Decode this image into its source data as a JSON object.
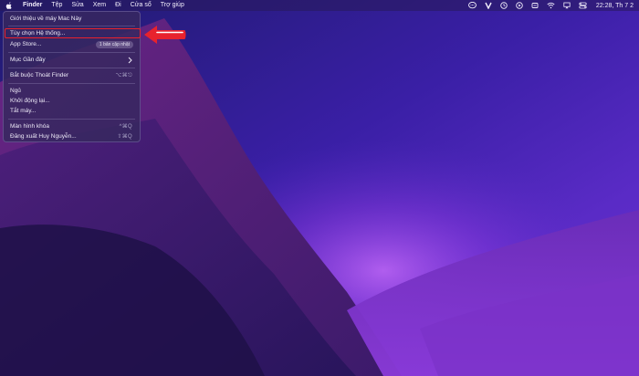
{
  "menubar": {
    "items": [
      "Finder",
      "Tệp",
      "Sửa",
      "Xem",
      "Đi",
      "Cửa sổ",
      "Trợ giúp"
    ],
    "clock": "22:28, Th 7 2"
  },
  "apple_menu": {
    "about": "Giới thiệu về máy Mac Này",
    "system_prefs": "Tùy chọn Hệ thống...",
    "app_store": "App Store...",
    "app_store_badge": "1 bản cập nhật",
    "recent_items": "Mục Gần đây",
    "force_quit": "Bắt buộc Thoát Finder",
    "force_quit_shortcut": "⌥⌘⎋",
    "sleep": "Ngủ",
    "restart": "Khởi động lại...",
    "shutdown": "Tắt máy...",
    "lock_screen": "Màn hình khóa",
    "lock_screen_shortcut": "^⌘Q",
    "logout": "Đăng xuất Huy Nguyễn...",
    "logout_shortcut": "⇧⌘Q"
  },
  "icons": {
    "apple": "apple-logo-icon",
    "status": [
      "messages-icon",
      "v-app-icon",
      "timer-icon",
      "play-icon",
      "focus-icon",
      "wifi-icon",
      "airplay-icon",
      "control-center-icon"
    ],
    "arrow": "red-arrow-icon"
  },
  "colors": {
    "highlight": "#e8222d",
    "arrow": "#e8222d"
  }
}
